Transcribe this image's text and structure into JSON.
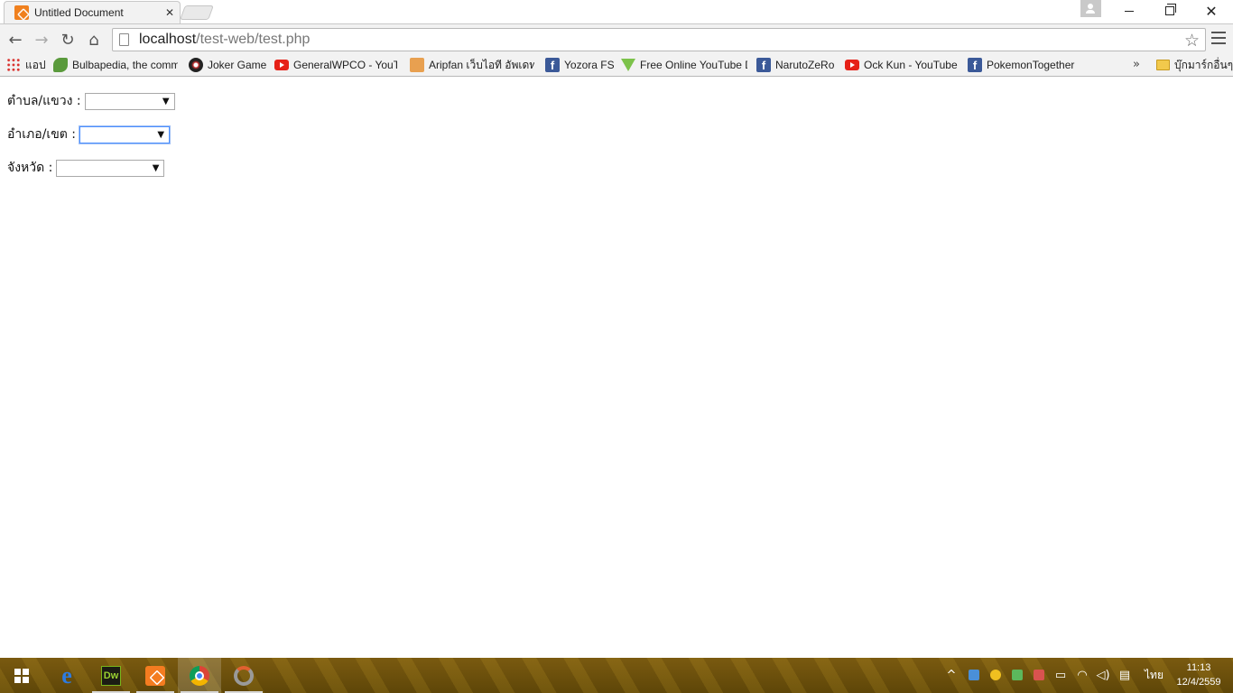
{
  "browser": {
    "tab_title": "Untitled Document",
    "tab_close": "✕",
    "url_host": "localhost",
    "url_path": "/test-web/test.php",
    "window_close": "✕"
  },
  "bookmarks": {
    "items": [
      {
        "label": "แอป",
        "icon": "apps-icon"
      },
      {
        "label": "Bulbapedia, the comm",
        "icon": "leaf-icon"
      },
      {
        "label": "Joker Game",
        "icon": "joker-icon"
      },
      {
        "label": "GeneralWPCO - YouTu",
        "icon": "youtube-icon"
      },
      {
        "label": "Aripfan เว็บไอที อัพเดทข่",
        "icon": "arip-icon"
      },
      {
        "label": "Yozora FS",
        "icon": "facebook-icon"
      },
      {
        "label": "Free Online YouTube D",
        "icon": "gem-icon"
      },
      {
        "label": "NarutoZeRo",
        "icon": "facebook-icon"
      },
      {
        "label": "Ock Kun - YouTube",
        "icon": "youtube-icon"
      },
      {
        "label": "PokemonTogether",
        "icon": "facebook-icon"
      }
    ],
    "more": "»",
    "other_folder": "บุ๊กมาร์กอื่นๆ"
  },
  "form": {
    "subdistrict_label": "ตำบล/แขวง :",
    "district_label": "อำเภอ/เขต :",
    "province_label": "จังหวัด :",
    "subdistrict_value": "",
    "district_value": "",
    "province_value": ""
  },
  "taskbar": {
    "dw_label": "Dw",
    "lang": "ไทย",
    "time": "11:13",
    "date": "12/4/2559"
  },
  "colors": {
    "tab_bg": "#f2f2f2",
    "taskbar": "#6b4f0c",
    "focus_ring": "#4d90fe"
  }
}
